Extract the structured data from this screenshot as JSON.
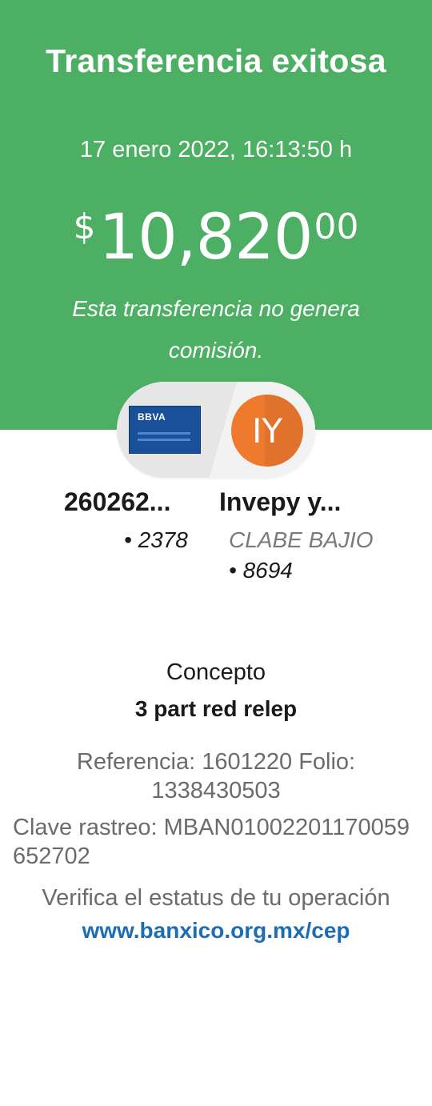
{
  "header": {
    "title": "Transferencia exitosa",
    "datetime": "17 enero 2022, 16:13:50 h",
    "amount_currency": "$",
    "amount_whole": "10,820",
    "amount_cents": "00",
    "commission_note": "Esta transferencia no genera comisión."
  },
  "colors": {
    "header_green": "#4caf63",
    "avatar_orange": "#ef7a2e",
    "bank_blue": "#1a4f9a",
    "link_blue": "#1e6db3"
  },
  "transfer": {
    "from": {
      "bank_logo_text": "BBVA",
      "name": "260262...",
      "digits": "• 2378"
    },
    "to": {
      "avatar_initials": "IY",
      "name": "Invepy y...",
      "bank": "CLABE BAJIO",
      "digits": "• 8694"
    }
  },
  "concept": {
    "label": "Concepto",
    "value": "3 part red relep"
  },
  "details": {
    "reference_line": "Referencia: 1601220   Folio: 1338430503",
    "rastreo_line": "Clave rastreo: MBAN01002201170059652702"
  },
  "verify": {
    "text": "Verifica el estatus de tu operación",
    "link": "www.banxico.org.mx/cep"
  }
}
